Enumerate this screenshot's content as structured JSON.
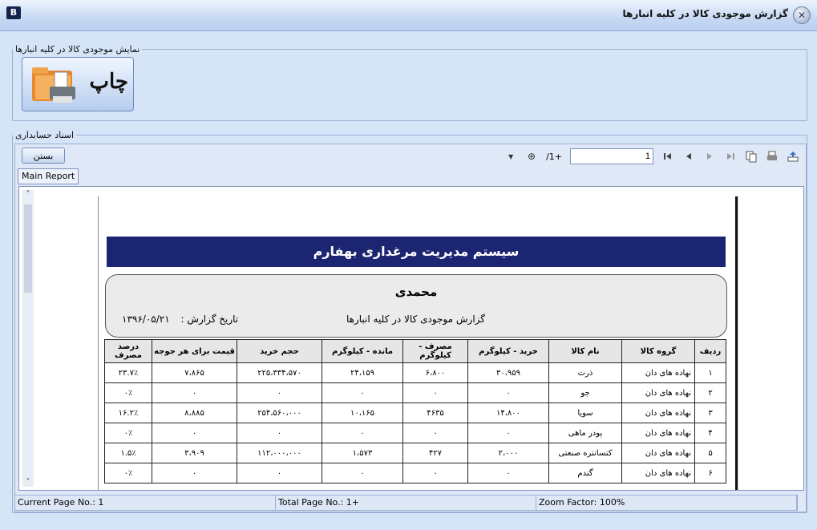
{
  "window": {
    "logo": "B",
    "title": "گزارش موجودی کالا در کلیه انبارها",
    "close_glyph": "✕"
  },
  "top_group": {
    "legend": "نمایش موجودی کالا در کلیه انبارها",
    "print_label": "چاپ"
  },
  "accounting_group": {
    "legend": "اسناد حسابداری"
  },
  "toolbar": {
    "close_label": "بستن",
    "page_value": "1",
    "page_total": "/1+",
    "zoom_glyph": "⊕",
    "dropdown_glyph": "▾"
  },
  "tab": {
    "label": "Main Report"
  },
  "report": {
    "banner": "سیستم مدیریت مرغداری بهفارم",
    "user": "محمدی",
    "name": "گزارش موجودی کالا در کلیه انبارها",
    "date_label": "تاریخ گزارش :",
    "date_value": "۱۳۹۶/۰۵/۲۱",
    "columns": [
      "ردیف",
      "گروه کالا",
      "نام کالا",
      "خرید - کیلوگرم",
      "مصرف - کیلوگرم",
      "مانده - کیلوگرم",
      "حجم خرید",
      "قیمت برای هر جوجه",
      "درصد مصرف"
    ],
    "rows": [
      [
        "۱",
        "نهاده های دان",
        "ذرت",
        "۳۰،۹۵۹",
        "۶،۸۰۰",
        "۲۴،۱۵۹",
        "۲۲۵،۳۳۴،۵۷۰",
        "۷،۸۶۵",
        "۲۳.۷٪"
      ],
      [
        "۲",
        "نهاده های دان",
        "جو",
        "۰",
        "۰",
        "۰",
        "۰",
        "۰",
        "۰٪"
      ],
      [
        "۳",
        "نهاده های دان",
        "سویا",
        "۱۴،۸۰۰",
        "۴۶۳۵",
        "۱۰،۱۶۵",
        "۲۵۴،۵۶۰،۰۰۰",
        "۸،۸۸۵",
        "۱۶.۲٪"
      ],
      [
        "۴",
        "نهاده های دان",
        "پودر ماهی",
        "۰",
        "۰",
        "۰",
        "۰",
        "۰",
        "۰٪"
      ],
      [
        "۵",
        "نهاده های دان",
        "کنسانتره صنعتی",
        "۲،۰۰۰",
        "۴۲۷",
        "۱،۵۷۳",
        "۱۱۲،۰۰۰،۰۰۰",
        "۳،۹۰۹",
        "۱.۵٪"
      ],
      [
        "۶",
        "نهاده های دان",
        "گندم",
        "۰",
        "۰",
        "۰",
        "۰",
        "۰",
        "۰٪"
      ]
    ]
  },
  "status": {
    "current_page": "Current Page No.: 1",
    "total_page": "Total Page No.: 1+",
    "zoom": "Zoom Factor: 100%"
  }
}
